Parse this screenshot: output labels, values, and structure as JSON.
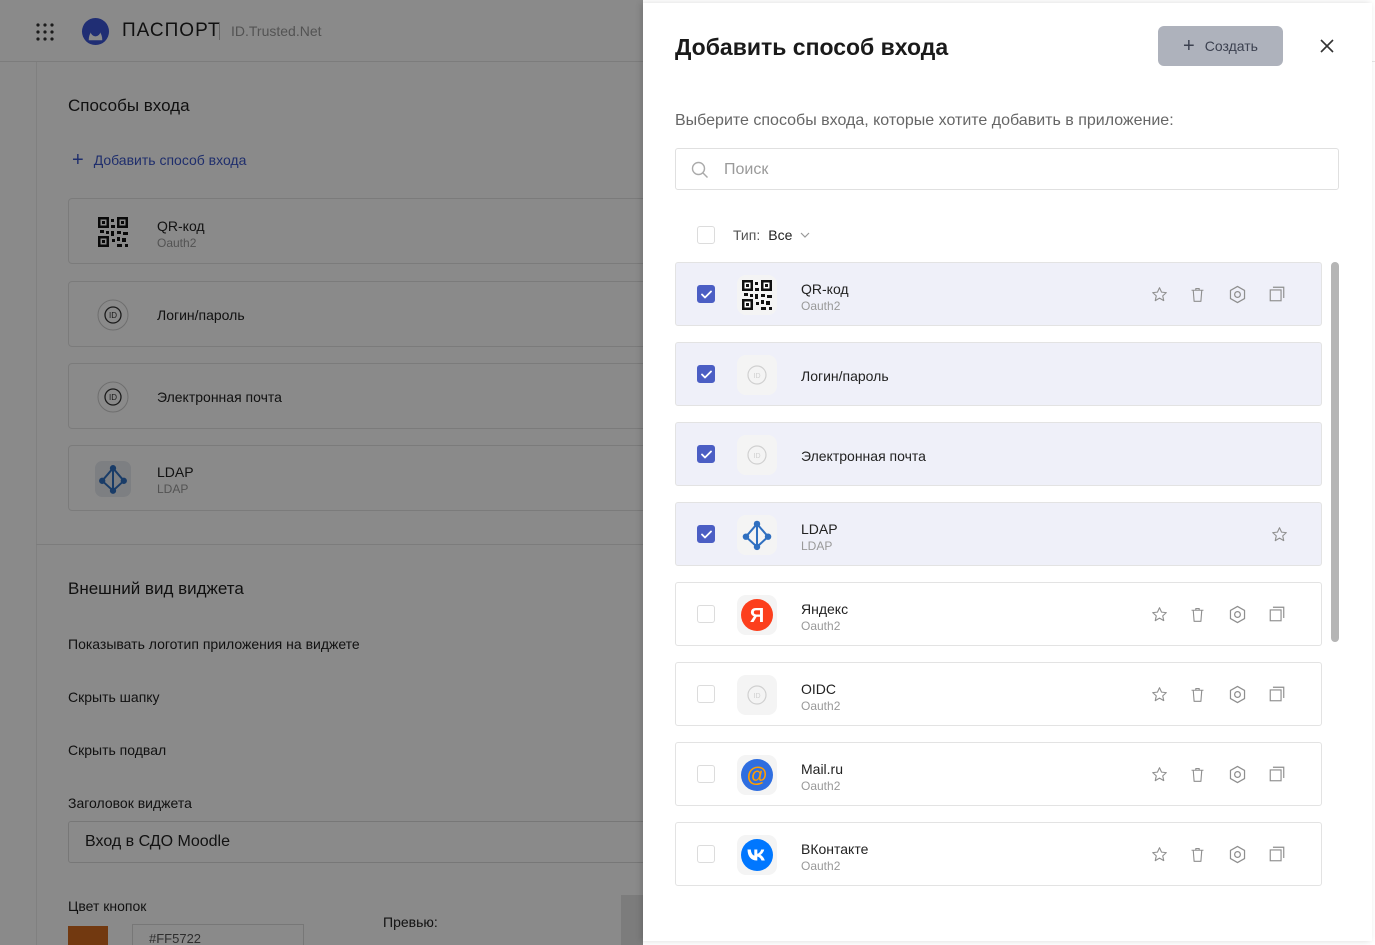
{
  "header": {
    "brand": "ПАСПОРТ",
    "domain": "ID.Trusted.Net"
  },
  "background": {
    "login_methods_title": "Способы входа",
    "add_link": "Добавить способ входа",
    "cards": [
      {
        "name": "QR-код",
        "type": "Oauth2",
        "icon": "qr-code-icon"
      },
      {
        "name": "Логин/пароль",
        "type": "",
        "icon": "id-badge-icon"
      },
      {
        "name": "Электронная почта",
        "type": "",
        "icon": "id-badge-icon"
      },
      {
        "name": "LDAP",
        "type": "LDAP",
        "icon": "ldap-network-icon"
      }
    ],
    "widget_title": "Внешний вид виджета",
    "options": [
      "Показывать логотип приложения на виджете",
      "Скрыть шапку",
      "Скрыть подвал"
    ],
    "widget_header_label": "Заголовок виджета",
    "widget_header_value": "Вход в СДО Moodle",
    "button_color_label": "Цвет кнопок",
    "button_color_value": "#FF5722",
    "button_color_hex": "#d2691e",
    "preview_label": "Превью:"
  },
  "drawer": {
    "title": "Добавить способ входа",
    "create_label": "Создать",
    "subtitle": "Выберите способы входа, которые хотите добавить в приложение:",
    "search_placeholder": "Поиск",
    "filter_label": "Тип:",
    "filter_value": "Все",
    "accent_color": "#4b5ec4",
    "items": [
      {
        "name": "QR-код",
        "type": "Oauth2",
        "checked": true,
        "icon": "qr-code-icon",
        "actions": [
          "star-icon",
          "trash-icon",
          "settings-icon",
          "copy-icon"
        ]
      },
      {
        "name": "Логин/пароль",
        "type": "",
        "checked": true,
        "icon": "id-badge-icon",
        "actions": []
      },
      {
        "name": "Электронная почта",
        "type": "",
        "checked": true,
        "icon": "id-badge-icon",
        "actions": []
      },
      {
        "name": "LDAP",
        "type": "LDAP",
        "checked": true,
        "icon": "ldap-network-icon",
        "actions": [
          "star-icon"
        ]
      },
      {
        "name": "Яндекс",
        "type": "Oauth2",
        "checked": false,
        "icon": "yandex-icon",
        "actions": [
          "star-icon",
          "trash-icon",
          "settings-icon",
          "copy-icon"
        ]
      },
      {
        "name": "OIDC",
        "type": "Oauth2",
        "checked": false,
        "icon": "id-badge-icon",
        "actions": [
          "star-icon",
          "trash-icon",
          "settings-icon",
          "copy-icon"
        ]
      },
      {
        "name": "Mail.ru",
        "type": "Oauth2",
        "checked": false,
        "icon": "mailru-icon",
        "actions": [
          "star-icon",
          "trash-icon",
          "settings-icon",
          "copy-icon"
        ]
      },
      {
        "name": "ВКонтакте",
        "type": "Oauth2",
        "checked": false,
        "icon": "vk-icon",
        "actions": [
          "star-icon",
          "trash-icon",
          "settings-icon",
          "copy-icon"
        ]
      }
    ]
  }
}
